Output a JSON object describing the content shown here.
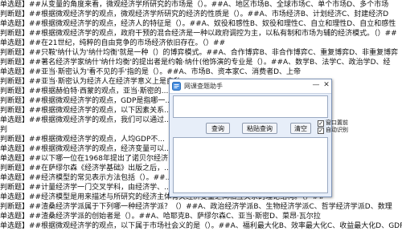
{
  "document": {
    "lines": [
      "单选题】##从变量的角度来看，微观经济学所研究的市场是（）。##A、地区市场B、全球市场C、单个市场D、多个市场",
      "判断题】##根据微观经济学的观点，微观经济学所研究的经济的性质是（）。##A、市场经济B、计划经济C、封建经济D",
      "单选题】##根据微观经济学的观点，经济人的特征是（）。##A、奴役和感性B、奴役和理性C、自立和理性D、自立和感性",
      "判断题】##根据微观经济学的观点，政府干预的混合经济是一种以政府调控为主，以私有制和市场为辅的经济模式。（）##",
      "单选题】##在21世纪，纯粹的自由竞争的市场经济依旧存在。（）##",
      "判断题】##只鞍'纳什认为'纳什均衡'就是一种（）的博弈模式。##A、合作博弈B、非合作博弈C、重复博弈D、非重复博弈",
      "判断题】##著名经济学家纳什'纳什均衡'的提出者是约翰·纳什(他饰演的专业是（）。##A、数学B、法学C、政治学D、经",
      "单选题】##亚当·斯密认为'看不见的手'指的是（）。##A、市场B、资本家C、消费者D、上帝",
      "判断题】##亚当·斯密认为经济人在经济学意义上是自私...",
      "判断题】##根据赫伯特·西蒙的观点，亚当·斯密的...",
      "判断题】##根据微观经济学的观点，GDP是指哪一...",
      "判断题】##根据微观经济学的观点，以下因素关系...",
      "单选题】##根据微观经济学的观点，我们可以通过...",
      "判",
      "判断题】##根据微观经济学的观点，人均GDP不...",
      "单选题】##根据微观经济学的观点，经济变量可以...",
      "单选题】##以下哪一位在1968年提出了诺贝尔经济...",
      "判断题】##在萨缪尔森《经济学基础》出版之后，...",
      "单选题】##经济模型的常见表示方法包括（）。##...",
      "判断题】##计量经济学一门交叉学科，由经济学、...",
      "单选题】##经济模型是用来描述与所研究的经济主体有关经济变量之间相互关系的理论结构。（）##",
      "判断题】##渣桑经济学派属于下列哪一种经济学派？（）##A、政治经济学派B、生物经济学派C、哲学经济学派D、数理",
      "单选题】##渣桑经济学派的创始者是（）。##A、哈耶克B、萨缪尔森C、亚当·斯密D、菜昂·瓦尔拉",
      "单选题】##根据微观经济学的观点，以下属于市场社会义的是（）。##A、福利最大化B、效率最大化C、收益最大化D、GDP"
    ]
  },
  "popup": {
    "title": "网课查题助手",
    "buttons": {
      "query": "查询",
      "paste_query": "粘贴查询",
      "clear": "清空"
    },
    "checkboxes": [
      {
        "label": "窗口置前",
        "checked": true
      },
      {
        "label": "自动识别",
        "checked": true
      }
    ],
    "query_input": {
      "value": ""
    },
    "result_text": "",
    "check_mark": "✓",
    "minimize_glyph": "—",
    "close_glyph": "✕"
  }
}
